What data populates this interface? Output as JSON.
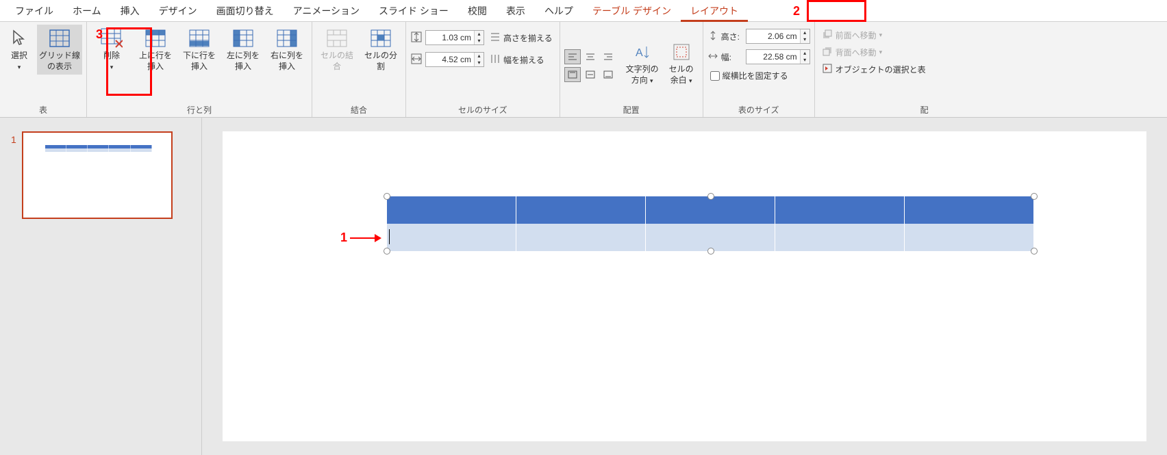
{
  "menu": {
    "items": [
      "ファイル",
      "ホーム",
      "挿入",
      "デザイン",
      "画面切り替え",
      "アニメーション",
      "スライド ショー",
      "校閲",
      "表示",
      "ヘルプ",
      "テーブル デザイン",
      "レイアウト"
    ]
  },
  "annotations": {
    "num1": "1",
    "num2": "2",
    "num3": "3"
  },
  "ribbon": {
    "table_group": {
      "label": "表",
      "select": "選択",
      "gridlines": "グリッド線の表示"
    },
    "rows_cols_group": {
      "label": "行と列",
      "delete": "削除",
      "insert_above": "上に行を挿入",
      "insert_below": "下に行を挿入",
      "insert_left": "左に列を挿入",
      "insert_right": "右に列を挿入"
    },
    "merge_group": {
      "label": "結合",
      "merge": "セルの結合",
      "split": "セルの分割"
    },
    "cell_size_group": {
      "label": "セルのサイズ",
      "height_value": "1.03 cm",
      "width_value": "4.52 cm",
      "dist_rows": "高さを揃える",
      "dist_cols": "幅を揃える"
    },
    "align_group": {
      "label": "配置",
      "text_dir": "文字列の方向",
      "cell_margin": "セルの余白"
    },
    "table_size_group": {
      "label": "表のサイズ",
      "height_label": "高さ:",
      "width_label": "幅:",
      "height_value": "2.06 cm",
      "width_value": "22.58 cm",
      "lock_ratio": "縦横比を固定する"
    },
    "arrange_group": {
      "label": "配",
      "bring_forward": "前面へ移動",
      "send_backward": "背面へ移動",
      "selection_pane": "オブジェクトの選択と表"
    }
  },
  "thumb": {
    "num": "1"
  }
}
